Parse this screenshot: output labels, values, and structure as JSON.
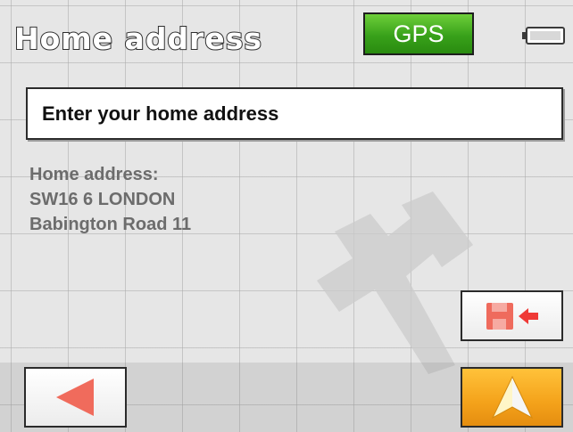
{
  "header": {
    "title": "Home address",
    "gps_label": "GPS",
    "battery_icon": "battery-icon"
  },
  "address_field": {
    "label": "Enter your home address"
  },
  "address_info": {
    "heading": "Home address:",
    "line1": "SW16 6 LONDON",
    "line2": "Babington Road 11"
  },
  "icons": {
    "watermark": "wrench-icon",
    "save": "save-to-icon",
    "back": "back-arrow-icon",
    "navigate": "navigate-arrow-icon"
  },
  "colors": {
    "gps_green": "#38a11a",
    "navigate_orange": "#f4a21a",
    "back_arrow_red": "#f06b5c",
    "background": "#e6e6e6"
  }
}
